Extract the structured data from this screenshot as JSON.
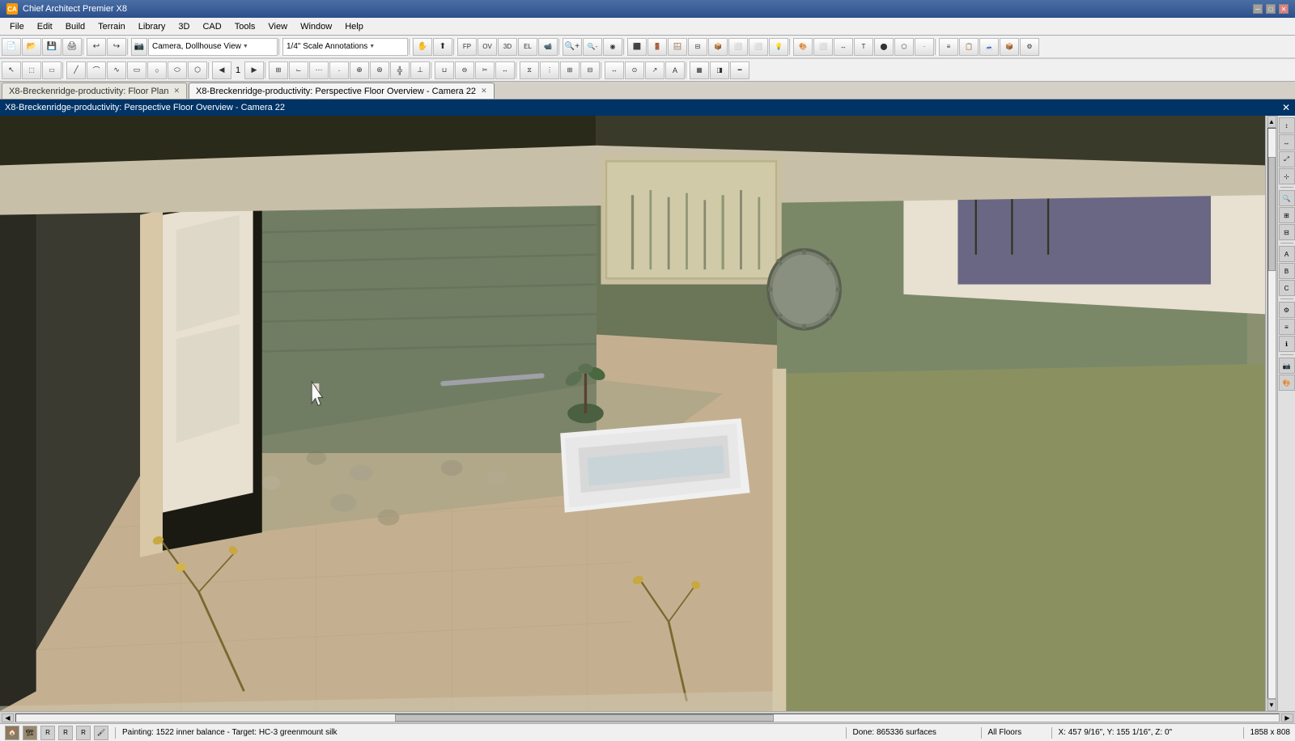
{
  "titleBar": {
    "title": "Chief Architect Premier X8",
    "icon": "CA",
    "controls": [
      "minimize",
      "maximize",
      "close"
    ]
  },
  "menuBar": {
    "items": [
      "File",
      "Edit",
      "Build",
      "Terrain",
      "Library",
      "3D",
      "CAD",
      "Tools",
      "View",
      "Window",
      "Help"
    ]
  },
  "toolbar1": {
    "cameraMode": "Camera, Dollhouse View",
    "scaleAnnotation": "1/4\" Scale Annotations",
    "buttons": [
      "new",
      "open",
      "save",
      "print",
      "undo",
      "redo",
      "camera",
      "camera2",
      "arrow1",
      "arrow2",
      "measure",
      "wall",
      "door",
      "window",
      "stair",
      "roof",
      "floor",
      "material",
      "light",
      "electrical",
      "plumbing",
      "terrain",
      "object",
      "dimension",
      "text",
      "symbol",
      "layers",
      "schedule"
    ]
  },
  "toolbar2": {
    "counter": "1",
    "buttons": [
      "select",
      "multi-select",
      "rectangular",
      "polyline",
      "transform",
      "align",
      "distribute",
      "offset",
      "array",
      "flip-h",
      "flip-v",
      "rotate",
      "group",
      "explode",
      "boolean-union",
      "boolean-subtract",
      "snap-grid",
      "snap-point",
      "snap-line",
      "snap-angle",
      "measure2",
      "trim",
      "extend",
      "fillet",
      "chamfer",
      "hatch",
      "dim-linear",
      "dim-aligned",
      "dim-angular",
      "dim-radius",
      "text-tool",
      "leader",
      "block",
      "layer-control"
    ]
  },
  "tabs": [
    {
      "id": "tab1",
      "label": "X8-Breckenridge-productivity: Floor Plan",
      "active": false,
      "closeable": true
    },
    {
      "id": "tab2",
      "label": "X8-Breckenridge-productivity: Perspective Floor Overview - Camera 22",
      "active": true,
      "closeable": true
    }
  ],
  "viewTitle": "X8-Breckenridge-productivity: Perspective Floor Overview - Camera 22",
  "rightPanel": {
    "buttons": [
      "zoom-in",
      "zoom-out",
      "zoom-extent",
      "zoom-window",
      "pan",
      "rotate3d",
      "orbit",
      "walk",
      "separator",
      "properties",
      "layer-display",
      "object-info",
      "separator2",
      "camera-settings",
      "render-settings"
    ]
  },
  "statusBar": {
    "icons": [
      "material1",
      "material2",
      "material3",
      "material4",
      "material5",
      "paintbrush"
    ],
    "painting": "Painting: 1522 inner balance - Target: HC-3 greenmount silk",
    "done": "Done:  865336 surfaces",
    "floors": "All Floors",
    "coords": "X: 457 9/16\", Y: 155 1/16\", Z: 0\"",
    "dimensions": "1858 x 808"
  }
}
